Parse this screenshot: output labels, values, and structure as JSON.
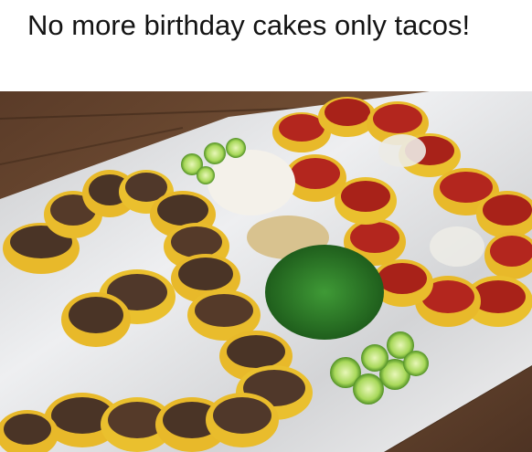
{
  "post": {
    "caption": "No more birthday cakes only tacos!"
  },
  "photo": {
    "subject": "taco platter arranged as the number 20",
    "colors": {
      "table": "#6b4a33",
      "foil": "#dfe0e2",
      "tortilla": "#e8b92a",
      "asada": "#4a3426",
      "pastor": "#b3261e",
      "cilantro": "#2e7d2a",
      "lime": "#8cc63f",
      "onion": "#f4f1ea"
    }
  }
}
